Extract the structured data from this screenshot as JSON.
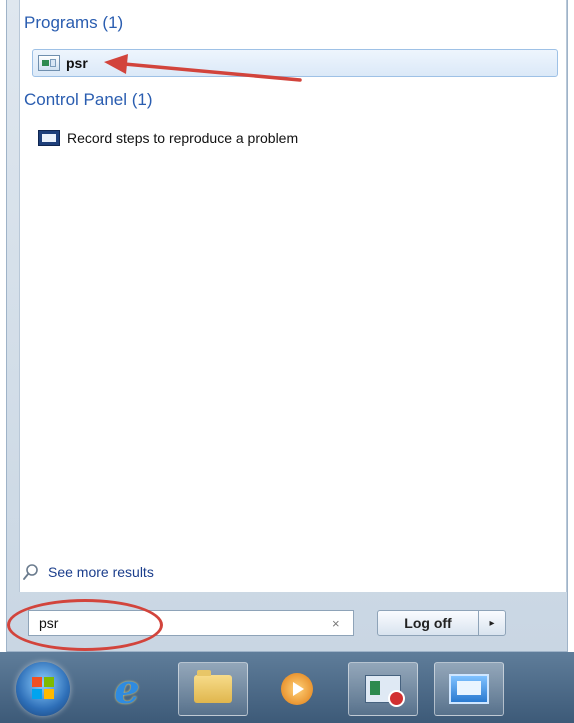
{
  "start_menu": {
    "groups": [
      {
        "header": "Programs (1)",
        "items": [
          {
            "label": "psr",
            "icon": "psr-app-icon",
            "highlighted": true
          }
        ]
      },
      {
        "header": "Control Panel (1)",
        "items": [
          {
            "label": "Record steps to reproduce a problem",
            "icon": "record-steps-icon"
          }
        ]
      }
    ],
    "see_more": {
      "label": "See more results",
      "icon": "search-icon"
    },
    "search": {
      "value": "psr",
      "clear_icon": "×"
    },
    "power": {
      "label": "Log off",
      "arrow": "▸"
    }
  },
  "annotations": {
    "arrow_color": "#d2443c",
    "circle_color": "#d2443c"
  },
  "taskbar": {
    "items": [
      {
        "name": "start-orb",
        "icon": "windows-orb-icon"
      },
      {
        "name": "internet-explorer",
        "icon": "internet-explorer-icon"
      },
      {
        "name": "windows-explorer",
        "icon": "folder-icon"
      },
      {
        "name": "windows-media-player",
        "icon": "media-player-icon"
      },
      {
        "name": "problem-steps-recorder",
        "icon": "psr-icon"
      },
      {
        "name": "remote-desktop",
        "icon": "remote-desktop-icon"
      }
    ]
  }
}
